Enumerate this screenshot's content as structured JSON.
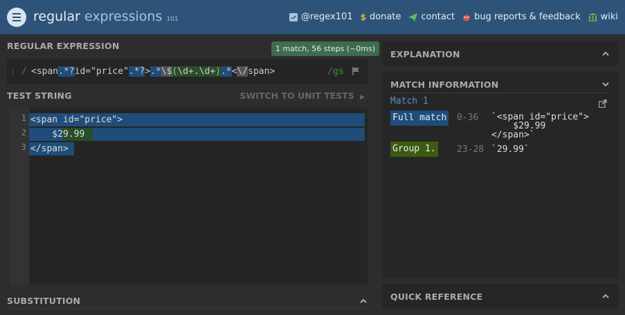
{
  "header": {
    "logo_main": "regular",
    "logo_light": " expressions",
    "logo_version": "101",
    "nav": [
      {
        "icon": "twitter-icon",
        "label": "@regex101"
      },
      {
        "icon": "dollar-icon",
        "label": "donate"
      },
      {
        "icon": "paper-plane-icon",
        "label": "contact"
      },
      {
        "icon": "bug-icon",
        "label": "bug reports & feedback"
      },
      {
        "icon": "bank-icon",
        "label": "wiki"
      }
    ]
  },
  "regex": {
    "title": "REGULAR EXPRESSION",
    "badge": "1 match, 56 steps (~0ms)",
    "open_delim": "/",
    "close_delim": "/",
    "parts": [
      "<span",
      ".*?",
      "id=\"price\"",
      ".*?",
      ">",
      ".*",
      "\\$",
      "(",
      "\\d+.\\d+",
      ")",
      ".*",
      "<",
      "\\/",
      "span>"
    ],
    "flags": "gs"
  },
  "test": {
    "title": "TEST STRING",
    "switch_label": "SWITCH TO UNIT TESTS",
    "lines": [
      "<span id=\"price\">",
      "    $29.99",
      "</span>"
    ],
    "line_numbers": [
      "1",
      "2",
      "3"
    ]
  },
  "substitution": {
    "title": "SUBSTITUTION"
  },
  "explanation": {
    "title": "EXPLANATION"
  },
  "match_info": {
    "title": "MATCH INFORMATION",
    "match_title": "Match 1",
    "full_label": "Full match",
    "full_range": "0-36",
    "full_value_1": "`<span id=\"price\">",
    "full_value_2": "    $29.99",
    "full_value_3": "</span>`",
    "group_label": "Group 1.",
    "group_range": "23-28",
    "group_value": "`29.99`"
  },
  "quick_reference": {
    "title": "QUICK REFERENCE"
  },
  "colors": {
    "header": "#2e5379",
    "match": "#1f4d7a",
    "group": "#2a4d2a",
    "badge": "#3f6b4e"
  }
}
